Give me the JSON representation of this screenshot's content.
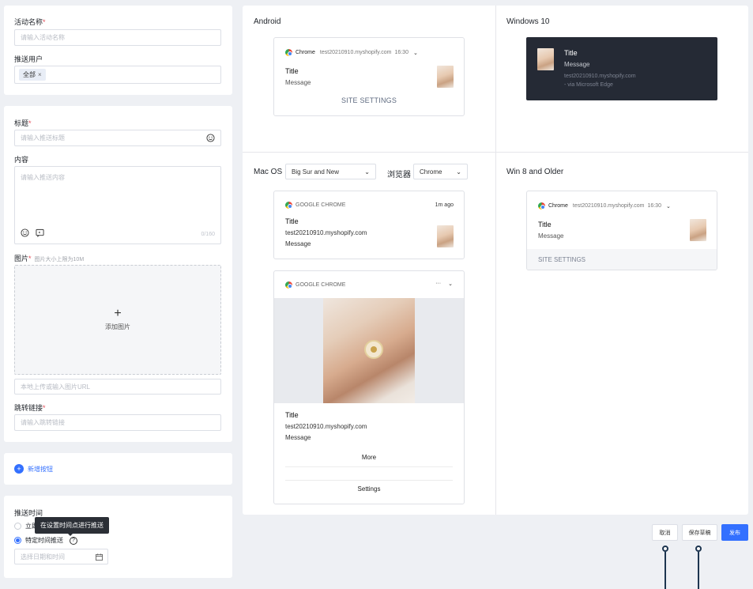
{
  "form": {
    "activity_name_label": "活动名称",
    "activity_name_placeholder": "请输入活动名称",
    "push_users_label": "推送用户",
    "push_users_tag": "全部",
    "title_label": "标题",
    "title_placeholder": "请输入推送标题",
    "content_label": "内容",
    "content_placeholder": "请输入推送内容",
    "content_counter": "0/160",
    "image_label": "图片",
    "image_hint": "图片大小上限为10M",
    "add_image_label": "添加图片",
    "image_url_placeholder": "本地上传或输入图片URL",
    "jump_link_label": "跳转链接",
    "jump_link_placeholder": "请输入跳转链接",
    "add_button_label": "新增按钮",
    "push_time_label": "推送时间",
    "radio_immediate": "立即",
    "tooltip": "在设置时间点进行推送",
    "radio_specific": "特定时间推送",
    "date_placeholder": "选择日期和时间"
  },
  "preview": {
    "android": {
      "pane_title": "Android",
      "browser": "Chrome",
      "site": "test20210910.myshopify.com",
      "time": "16:30",
      "title": "Title",
      "message": "Message",
      "action": "SITE SETTINGS"
    },
    "windows10": {
      "pane_title": "Windows 10",
      "title": "Title",
      "message": "Message",
      "site": "test20210910.myshopify.com",
      "via": "- via Microsoft Edge"
    },
    "mac": {
      "pane_title": "Mac OS",
      "os_select": "Big Sur and New",
      "browser_label": "浏览器",
      "browser_select": "Chrome",
      "card1": {
        "browser": "GOOGLE CHROME",
        "time": "1m ago",
        "title": "Title",
        "site": "test20210910.myshopify.com",
        "message": "Message"
      },
      "card2": {
        "browser": "GOOGLE CHROME",
        "dots": "···",
        "title": "Title",
        "site": "test20210910.myshopify.com",
        "message": "Message",
        "more": "More",
        "settings": "Settings"
      }
    },
    "win8": {
      "pane_title": "Win 8 and Older",
      "browser": "Chrome",
      "site": "test20210910.myshopify.com",
      "time": "16:30",
      "title": "Title",
      "message": "Message",
      "action": "SITE SETTINGS"
    }
  },
  "actions": {
    "cancel": "取消",
    "save_draft": "保存草稿",
    "publish": "发布"
  },
  "colors": {
    "primary": "#3370ff",
    "required": "#e34d59",
    "dark_toast": "#252a35"
  }
}
